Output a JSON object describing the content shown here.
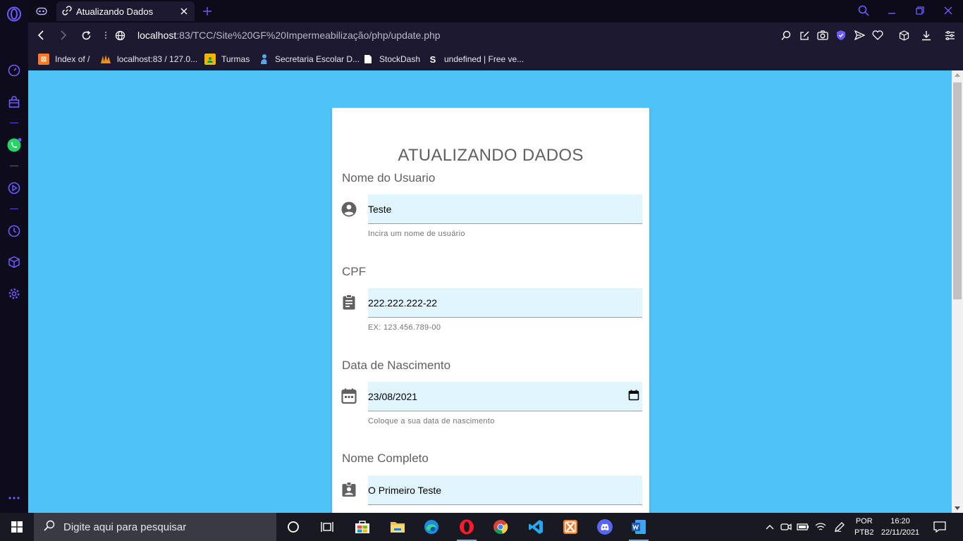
{
  "colors": {
    "page_bg": "#4fc3f7",
    "card_bg": "#ffffff",
    "field_bg": "#e1f5fe",
    "accent": "#5b4ad8",
    "text_gray": "#616161"
  },
  "browser": {
    "tab_title": "Atualizando Dados",
    "url_host": "localhost",
    "url_rest": ":83/TCC/Site%20GF%20Impermeabilização/php/update.php",
    "bookmarks": [
      {
        "label": "Index of /",
        "icon": "xampp-icon"
      },
      {
        "label": "localhost:83 / 127.0...",
        "icon": "phpmyadmin-icon"
      },
      {
        "label": "Turmas",
        "icon": "classroom-icon"
      },
      {
        "label": "Secretaria Escolar D...",
        "icon": "secretaria-icon"
      },
      {
        "label": "StockDash",
        "icon": "page-icon"
      },
      {
        "label": "undefined | Free ve...",
        "icon": "s-logo-icon"
      }
    ]
  },
  "form": {
    "title": "ATUALIZANDO DADOS",
    "username": {
      "label": "Nome do Usuario",
      "value": "Teste",
      "helper": "Incira um nome de usuário",
      "icon": "account-circle-icon"
    },
    "cpf": {
      "label": "CPF",
      "value": "222.222.222-22",
      "helper": "EX: 123.456.789-00",
      "icon": "clipboard-icon"
    },
    "birthdate": {
      "label": "Data de Nascimento",
      "value": "23/08/2021",
      "helper": "Coloque a sua data de nascimento",
      "icon": "calendar-icon"
    },
    "fullname": {
      "label": "Nome Completo",
      "value": "O Primeiro Teste",
      "icon": "contact-badge-icon"
    }
  },
  "taskbar": {
    "search_placeholder": "Digite aqui para pesquisar",
    "lang_line1": "POR",
    "lang_line2": "PTB2",
    "time": "16:20",
    "date": "22/11/2021"
  }
}
